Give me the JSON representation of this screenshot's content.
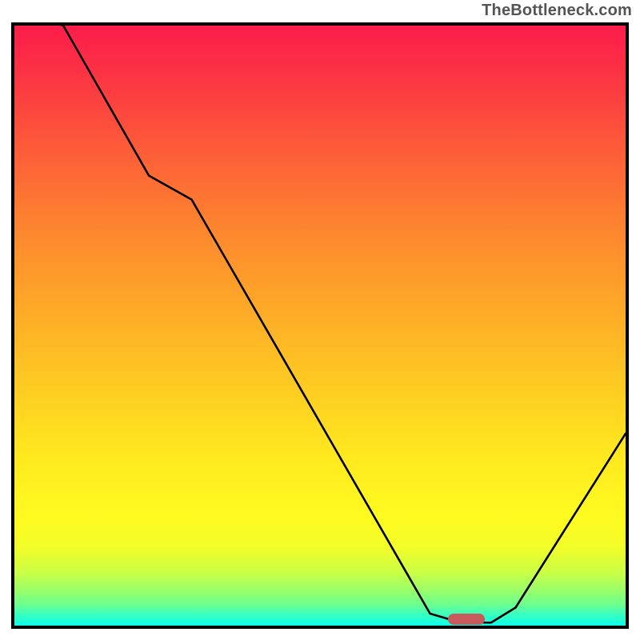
{
  "watermark": "TheBottleneck.com",
  "marker": {
    "x_pct": 74,
    "width_pct": 6,
    "color": "#c85a5c"
  },
  "chart_data": {
    "type": "line",
    "title": "",
    "xlabel": "",
    "ylabel": "",
    "xlim": [
      0,
      100
    ],
    "ylim": [
      0,
      100
    ],
    "series": [
      {
        "name": "curve",
        "x": [
          0,
          8,
          22,
          29,
          68,
          73,
          78,
          82,
          100
        ],
        "y": [
          103,
          100,
          75,
          71,
          2,
          0.5,
          0.5,
          3,
          32
        ]
      }
    ],
    "gradient_stops": [
      {
        "pct": 0,
        "color": "#fc1d4b"
      },
      {
        "pct": 7,
        "color": "#fc3044"
      },
      {
        "pct": 20,
        "color": "#fd5a39"
      },
      {
        "pct": 32,
        "color": "#fd8030"
      },
      {
        "pct": 45,
        "color": "#fea429"
      },
      {
        "pct": 58,
        "color": "#fec623"
      },
      {
        "pct": 72,
        "color": "#ffe91f"
      },
      {
        "pct": 82,
        "color": "#fffb20"
      },
      {
        "pct": 87,
        "color": "#f2fd2a"
      },
      {
        "pct": 91,
        "color": "#ccff44"
      },
      {
        "pct": 94,
        "color": "#9cff68"
      },
      {
        "pct": 96.5,
        "color": "#6dff8f"
      },
      {
        "pct": 98.5,
        "color": "#2fffc9"
      },
      {
        "pct": 100,
        "color": "#0effe9"
      }
    ]
  }
}
